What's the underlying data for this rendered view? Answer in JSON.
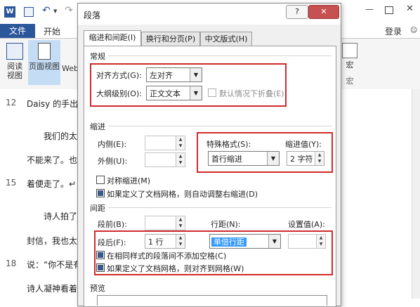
{
  "word": {
    "file_tab": "文件",
    "home_tab": "开始",
    "login": "登录",
    "ribbon": {
      "read_view": [
        "阅读",
        "视图"
      ],
      "page_view": "页面视图",
      "web_view": "Web",
      "macro_label": "宏",
      "macro_group": "宏"
    },
    "doc_lines": [
      {
        "num": "12",
        "text": "Daisy 的手出去"
      },
      {
        "num": "",
        "text": "我们的太ノ"
      },
      {
        "num": "",
        "text": "不能来了。也吗"
      },
      {
        "num": "15",
        "text": "着便走了。↵"
      },
      {
        "num": "",
        "text": "诗人拍了拍"
      },
      {
        "num": "",
        "text": "封信，我也太懒"
      },
      {
        "num": "18",
        "text": "说：“你不是有"
      },
      {
        "num": "",
        "text": "诗人凝神看着炉"
      }
    ]
  },
  "dialog": {
    "title": "段落",
    "help": "?",
    "close": "✕",
    "tabs": [
      {
        "label": "缩进和间距(I)",
        "active": true
      },
      {
        "label": "换行和分页(P)",
        "active": false
      },
      {
        "label": "中文版式(H)",
        "active": false
      }
    ],
    "general": {
      "header": "常规",
      "alignment_label": "对齐方式(G):",
      "alignment_value": "左对齐",
      "outline_label": "大纲级别(O):",
      "outline_value": "正文文本",
      "collapse_label": "默认情况下折叠(E)"
    },
    "indent": {
      "header": "缩进",
      "inside_label": "内侧(E):",
      "outside_label": "外侧(U):",
      "special_label": "特殊格式(S):",
      "special_value": "首行缩进",
      "by_label": "缩进值(Y):",
      "by_value": "2 字符",
      "mirror_label": "对称缩进(M)",
      "auto_adjust_label": "如果定义了文档网格，则自动调整右缩进(D)"
    },
    "spacing": {
      "header": "间距",
      "before_label": "段前(B):",
      "after_label": "段后(F):",
      "after_value": "1 行",
      "line_spacing_label": "行距(N):",
      "line_spacing_value": "单倍行距",
      "at_label": "设置值(A):",
      "no_space_label": "在相同样式的段落间不添加空格(C)",
      "snap_grid_label": "如果定义了文档网格，则对齐到网格(W)"
    },
    "preview": {
      "header": "预览"
    }
  },
  "colors": {
    "highlight": "#d12a2a",
    "word_blue": "#2b579a",
    "selection": "#3399ff"
  }
}
